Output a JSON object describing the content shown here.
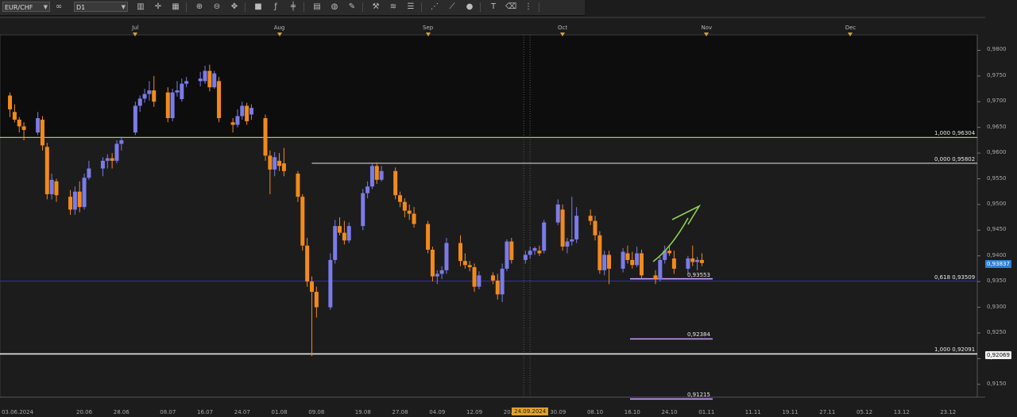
{
  "toolbar": {
    "symbol": "EUR/CHF",
    "timeframe": "D1",
    "icons": [
      "link-icon",
      "candles-icon",
      "crosshair-icon",
      "bar-chart-icon",
      "zoom-in-icon",
      "zoom-out-icon",
      "drag-icon",
      "color-icon",
      "indicator-icon",
      "hline-icon",
      "template-icon",
      "palette-icon",
      "pencil-icon",
      "tools-icon",
      "channel-icon",
      "fibo-icon",
      "gann-icon",
      "trend-icon",
      "shape-icon",
      "text-icon",
      "eraser-icon",
      "settings-icon"
    ]
  },
  "months": [
    {
      "label": "Jul",
      "date": "2024-07-01"
    },
    {
      "label": "Aug",
      "date": "2024-08-01"
    },
    {
      "label": "Sep",
      "date": "2024-09-02"
    },
    {
      "label": "Oct",
      "date": "2024-10-01"
    },
    {
      "label": "Nov",
      "date": "2024-11-01"
    },
    {
      "label": "Dec",
      "date": "2024-12-02"
    }
  ],
  "x_labels": [
    {
      "label": "03.06.2024",
      "date": "2024-06-03"
    },
    {
      "label": "20.06",
      "date": "2024-06-20"
    },
    {
      "label": "28.06",
      "date": "2024-06-28"
    },
    {
      "label": "08.07",
      "date": "2024-07-08"
    },
    {
      "label": "16.07",
      "date": "2024-07-16"
    },
    {
      "label": "24.07",
      "date": "2024-07-24"
    },
    {
      "label": "01.08",
      "date": "2024-08-01"
    },
    {
      "label": "09.08",
      "date": "2024-08-09"
    },
    {
      "label": "19.08",
      "date": "2024-08-19"
    },
    {
      "label": "27.08",
      "date": "2024-08-27"
    },
    {
      "label": "04.09",
      "date": "2024-09-04"
    },
    {
      "label": "12.09",
      "date": "2024-09-12"
    },
    {
      "label": "20.09",
      "date": "2024-09-20"
    },
    {
      "label": "30.09",
      "date": "2024-09-30"
    },
    {
      "label": "08.10",
      "date": "2024-10-08"
    },
    {
      "label": "16.10",
      "date": "2024-10-16"
    },
    {
      "label": "24.10",
      "date": "2024-10-24"
    },
    {
      "label": "01.11",
      "date": "2024-11-01"
    },
    {
      "label": "11.11",
      "date": "2024-11-11"
    },
    {
      "label": "19.11",
      "date": "2024-11-19"
    },
    {
      "label": "27.11",
      "date": "2024-11-27"
    },
    {
      "label": "05.12",
      "date": "2024-12-05"
    },
    {
      "label": "13.12",
      "date": "2024-12-13"
    },
    {
      "label": "23.12",
      "date": "2024-12-23"
    }
  ],
  "crosshair": {
    "label": "24.09.2024",
    "date": "2024-09-24"
  },
  "price_axis": [
    "0,9800",
    "0,9750",
    "0,9700",
    "0,9650",
    "0,9600",
    "0,9550",
    "0,9500",
    "0,9450",
    "0,9400",
    "0,9350",
    "0,9300",
    "0,9250",
    "0,9200",
    "0,9150"
  ],
  "levels": [
    {
      "label": "1,000 0,96304",
      "price": 0.96304,
      "color": "#8fd14f"
    },
    {
      "label": "0,000 0,95802",
      "price": 0.95802,
      "color": "#cfcfcf"
    },
    {
      "label": "0,618 0,93509",
      "price": 0.93509,
      "color": "#2c2ca8"
    },
    {
      "label": "1,000 0,92091",
      "price": 0.92091,
      "color": "#e8e8e8"
    }
  ],
  "targets": [
    {
      "label": "0,93553",
      "price": 0.93553
    },
    {
      "label": "0,92384",
      "price": 0.92384
    },
    {
      "label": "0,91215",
      "price": 0.91215
    }
  ],
  "current_price": {
    "label": "0,93837",
    "price": 0.93837
  },
  "low_marker": {
    "label": "0,92069",
    "price": 0.92069
  },
  "colors": {
    "bull": "#7b7be8",
    "bear": "#f28a1c",
    "arrow": "#8fd14f",
    "target": "#c9a0ff"
  },
  "chart_data": {
    "type": "candlestick",
    "title": "EUR/CHF D1",
    "ylim": [
      0.9125,
      0.983
    ],
    "ohlc": [
      {
        "date": "2024-06-04",
        "o": 0.9712,
        "h": 0.9718,
        "l": 0.967,
        "c": 0.9685
      },
      {
        "date": "2024-06-05",
        "o": 0.968,
        "h": 0.9695,
        "l": 0.966,
        "c": 0.9665
      },
      {
        "date": "2024-06-06",
        "o": 0.9665,
        "h": 0.967,
        "l": 0.964,
        "c": 0.9652
      },
      {
        "date": "2024-06-07",
        "o": 0.9652,
        "h": 0.966,
        "l": 0.9625,
        "c": 0.9645
      },
      {
        "date": "2024-06-10",
        "o": 0.964,
        "h": 0.968,
        "l": 0.9635,
        "c": 0.9668
      },
      {
        "date": "2024-06-11",
        "o": 0.9665,
        "h": 0.9672,
        "l": 0.9605,
        "c": 0.9615
      },
      {
        "date": "2024-06-12",
        "o": 0.9612,
        "h": 0.962,
        "l": 0.951,
        "c": 0.952
      },
      {
        "date": "2024-06-13",
        "o": 0.952,
        "h": 0.956,
        "l": 0.951,
        "c": 0.9548
      },
      {
        "date": "2024-06-14",
        "o": 0.9545,
        "h": 0.955,
        "l": 0.9505,
        "c": 0.9518
      },
      {
        "date": "2024-06-17",
        "o": 0.9515,
        "h": 0.9528,
        "l": 0.948,
        "c": 0.949
      },
      {
        "date": "2024-06-18",
        "o": 0.949,
        "h": 0.9535,
        "l": 0.948,
        "c": 0.9525
      },
      {
        "date": "2024-06-19",
        "o": 0.9525,
        "h": 0.9545,
        "l": 0.9485,
        "c": 0.9495
      },
      {
        "date": "2024-06-20",
        "o": 0.9495,
        "h": 0.956,
        "l": 0.949,
        "c": 0.9552
      },
      {
        "date": "2024-06-21",
        "o": 0.9552,
        "h": 0.9585,
        "l": 0.9548,
        "c": 0.957
      },
      {
        "date": "2024-06-24",
        "o": 0.957,
        "h": 0.9592,
        "l": 0.9555,
        "c": 0.9585
      },
      {
        "date": "2024-06-25",
        "o": 0.9585,
        "h": 0.9598,
        "l": 0.957,
        "c": 0.959
      },
      {
        "date": "2024-06-26",
        "o": 0.959,
        "h": 0.96,
        "l": 0.957,
        "c": 0.9585
      },
      {
        "date": "2024-06-27",
        "o": 0.9585,
        "h": 0.9625,
        "l": 0.958,
        "c": 0.9618
      },
      {
        "date": "2024-06-28",
        "o": 0.9618,
        "h": 0.9632,
        "l": 0.9605,
        "c": 0.9625
      },
      {
        "date": "2024-07-01",
        "o": 0.964,
        "h": 0.97,
        "l": 0.9635,
        "c": 0.9692
      },
      {
        "date": "2024-07-02",
        "o": 0.9692,
        "h": 0.9712,
        "l": 0.968,
        "c": 0.9706
      },
      {
        "date": "2024-07-03",
        "o": 0.9706,
        "h": 0.9725,
        "l": 0.9698,
        "c": 0.9715
      },
      {
        "date": "2024-07-04",
        "o": 0.9715,
        "h": 0.974,
        "l": 0.9702,
        "c": 0.9722
      },
      {
        "date": "2024-07-05",
        "o": 0.9722,
        "h": 0.975,
        "l": 0.969,
        "c": 0.97
      },
      {
        "date": "2024-07-08",
        "o": 0.9718,
        "h": 0.9728,
        "l": 0.966,
        "c": 0.9668
      },
      {
        "date": "2024-07-09",
        "o": 0.9668,
        "h": 0.9725,
        "l": 0.9662,
        "c": 0.9718
      },
      {
        "date": "2024-07-10",
        "o": 0.9718,
        "h": 0.974,
        "l": 0.971,
        "c": 0.9722
      },
      {
        "date": "2024-07-11",
        "o": 0.9705,
        "h": 0.9745,
        "l": 0.97,
        "c": 0.9735
      },
      {
        "date": "2024-07-12",
        "o": 0.9735,
        "h": 0.9748,
        "l": 0.9728,
        "c": 0.974
      },
      {
        "date": "2024-07-15",
        "o": 0.974,
        "h": 0.9758,
        "l": 0.973,
        "c": 0.9745
      },
      {
        "date": "2024-07-16",
        "o": 0.974,
        "h": 0.977,
        "l": 0.9735,
        "c": 0.976
      },
      {
        "date": "2024-07-17",
        "o": 0.976,
        "h": 0.9772,
        "l": 0.972,
        "c": 0.9728
      },
      {
        "date": "2024-07-18",
        "o": 0.9728,
        "h": 0.976,
        "l": 0.9725,
        "c": 0.9755
      },
      {
        "date": "2024-07-19",
        "o": 0.974,
        "h": 0.9748,
        "l": 0.966,
        "c": 0.9668
      },
      {
        "date": "2024-07-22",
        "o": 0.966,
        "h": 0.9668,
        "l": 0.964,
        "c": 0.9655
      },
      {
        "date": "2024-07-23",
        "o": 0.9655,
        "h": 0.9685,
        "l": 0.965,
        "c": 0.9672
      },
      {
        "date": "2024-07-24",
        "o": 0.9672,
        "h": 0.97,
        "l": 0.9665,
        "c": 0.9692
      },
      {
        "date": "2024-07-25",
        "o": 0.9692,
        "h": 0.9698,
        "l": 0.9655,
        "c": 0.9662
      },
      {
        "date": "2024-07-26",
        "o": 0.9675,
        "h": 0.9695,
        "l": 0.9665,
        "c": 0.9688
      },
      {
        "date": "2024-07-29",
        "o": 0.9668,
        "h": 0.9675,
        "l": 0.9585,
        "c": 0.9595
      },
      {
        "date": "2024-07-30",
        "o": 0.9595,
        "h": 0.9605,
        "l": 0.952,
        "c": 0.9568
      },
      {
        "date": "2024-07-31",
        "o": 0.9568,
        "h": 0.9602,
        "l": 0.9555,
        "c": 0.9592
      },
      {
        "date": "2024-08-01",
        "o": 0.9585,
        "h": 0.96,
        "l": 0.9565,
        "c": 0.9575
      },
      {
        "date": "2024-08-02",
        "o": 0.958,
        "h": 0.961,
        "l": 0.9555,
        "c": 0.9565
      },
      {
        "date": "2024-08-05",
        "o": 0.956,
        "h": 0.9565,
        "l": 0.9505,
        "c": 0.9515
      },
      {
        "date": "2024-08-06",
        "o": 0.9515,
        "h": 0.952,
        "l": 0.941,
        "c": 0.942
      },
      {
        "date": "2024-08-07",
        "o": 0.942,
        "h": 0.9435,
        "l": 0.934,
        "c": 0.935
      },
      {
        "date": "2024-08-08",
        "o": 0.935,
        "h": 0.936,
        "l": 0.9205,
        "c": 0.933
      },
      {
        "date": "2024-08-09",
        "o": 0.933,
        "h": 0.934,
        "l": 0.928,
        "c": 0.93
      },
      {
        "date": "2024-08-12",
        "o": 0.93,
        "h": 0.9405,
        "l": 0.9295,
        "c": 0.9392
      },
      {
        "date": "2024-08-13",
        "o": 0.9392,
        "h": 0.947,
        "l": 0.9385,
        "c": 0.9458
      },
      {
        "date": "2024-08-14",
        "o": 0.9458,
        "h": 0.9475,
        "l": 0.944,
        "c": 0.9445
      },
      {
        "date": "2024-08-15",
        "o": 0.9445,
        "h": 0.9468,
        "l": 0.9422,
        "c": 0.943
      },
      {
        "date": "2024-08-16",
        "o": 0.943,
        "h": 0.9465,
        "l": 0.9425,
        "c": 0.9458
      },
      {
        "date": "2024-08-19",
        "o": 0.9458,
        "h": 0.953,
        "l": 0.945,
        "c": 0.9522
      },
      {
        "date": "2024-08-20",
        "o": 0.9522,
        "h": 0.9545,
        "l": 0.9512,
        "c": 0.9535
      },
      {
        "date": "2024-08-21",
        "o": 0.9535,
        "h": 0.958,
        "l": 0.953,
        "c": 0.9575
      },
      {
        "date": "2024-08-22",
        "o": 0.9575,
        "h": 0.9582,
        "l": 0.954,
        "c": 0.9548
      },
      {
        "date": "2024-08-23",
        "o": 0.9548,
        "h": 0.9575,
        "l": 0.9545,
        "c": 0.9565
      },
      {
        "date": "2024-08-26",
        "o": 0.9565,
        "h": 0.9572,
        "l": 0.951,
        "c": 0.9518
      },
      {
        "date": "2024-08-27",
        "o": 0.9518,
        "h": 0.9525,
        "l": 0.9495,
        "c": 0.9505
      },
      {
        "date": "2024-08-28",
        "o": 0.9505,
        "h": 0.9512,
        "l": 0.9475,
        "c": 0.9488
      },
      {
        "date": "2024-08-29",
        "o": 0.9488,
        "h": 0.95,
        "l": 0.947,
        "c": 0.9482
      },
      {
        "date": "2024-08-30",
        "o": 0.9482,
        "h": 0.9495,
        "l": 0.9455,
        "c": 0.9462
      },
      {
        "date": "2024-09-02",
        "o": 0.9462,
        "h": 0.9468,
        "l": 0.9405,
        "c": 0.9412
      },
      {
        "date": "2024-09-03",
        "o": 0.9412,
        "h": 0.9418,
        "l": 0.935,
        "c": 0.936
      },
      {
        "date": "2024-09-04",
        "o": 0.936,
        "h": 0.9372,
        "l": 0.9345,
        "c": 0.9365
      },
      {
        "date": "2024-09-05",
        "o": 0.9365,
        "h": 0.938,
        "l": 0.9355,
        "c": 0.9372
      },
      {
        "date": "2024-09-06",
        "o": 0.9372,
        "h": 0.9435,
        "l": 0.9365,
        "c": 0.9425
      },
      {
        "date": "2024-09-09",
        "o": 0.9425,
        "h": 0.944,
        "l": 0.938,
        "c": 0.939
      },
      {
        "date": "2024-09-10",
        "o": 0.939,
        "h": 0.9405,
        "l": 0.9375,
        "c": 0.9382
      },
      {
        "date": "2024-09-11",
        "o": 0.9382,
        "h": 0.939,
        "l": 0.937,
        "c": 0.9378
      },
      {
        "date": "2024-09-12",
        "o": 0.9378,
        "h": 0.9385,
        "l": 0.933,
        "c": 0.934
      },
      {
        "date": "2024-09-13",
        "o": 0.934,
        "h": 0.937,
        "l": 0.9335,
        "c": 0.9362
      },
      {
        "date": "2024-09-16",
        "o": 0.9362,
        "h": 0.9368,
        "l": 0.9345,
        "c": 0.9352
      },
      {
        "date": "2024-09-17",
        "o": 0.9352,
        "h": 0.9365,
        "l": 0.9315,
        "c": 0.9325
      },
      {
        "date": "2024-09-18",
        "o": 0.9325,
        "h": 0.9385,
        "l": 0.931,
        "c": 0.9375
      },
      {
        "date": "2024-09-19",
        "o": 0.9375,
        "h": 0.9432,
        "l": 0.937,
        "c": 0.9428
      },
      {
        "date": "2024-09-20",
        "o": 0.9428,
        "h": 0.9435,
        "l": 0.9385,
        "c": 0.9392
      },
      {
        "date": "2024-09-23",
        "o": 0.9392,
        "h": 0.941,
        "l": 0.9385,
        "c": 0.9402
      },
      {
        "date": "2024-09-24",
        "o": 0.9402,
        "h": 0.9418,
        "l": 0.9395,
        "c": 0.941
      },
      {
        "date": "2024-09-25",
        "o": 0.941,
        "h": 0.9418,
        "l": 0.9402,
        "c": 0.9415
      },
      {
        "date": "2024-09-26",
        "o": 0.941,
        "h": 0.942,
        "l": 0.94,
        "c": 0.9405
      },
      {
        "date": "2024-09-27",
        "o": 0.941,
        "h": 0.947,
        "l": 0.9405,
        "c": 0.9465
      },
      {
        "date": "2024-09-30",
        "o": 0.9465,
        "h": 0.951,
        "l": 0.946,
        "c": 0.95
      },
      {
        "date": "2024-10-01",
        "o": 0.949,
        "h": 0.95,
        "l": 0.941,
        "c": 0.9418
      },
      {
        "date": "2024-10-02",
        "o": 0.9418,
        "h": 0.9435,
        "l": 0.9405,
        "c": 0.9428
      },
      {
        "date": "2024-10-03",
        "o": 0.9428,
        "h": 0.9515,
        "l": 0.942,
        "c": 0.9432
      },
      {
        "date": "2024-10-04",
        "o": 0.9432,
        "h": 0.9495,
        "l": 0.9425,
        "c": 0.9478
      },
      {
        "date": "2024-10-07",
        "o": 0.9478,
        "h": 0.949,
        "l": 0.946,
        "c": 0.9468
      },
      {
        "date": "2024-10-08",
        "o": 0.9468,
        "h": 0.9478,
        "l": 0.943,
        "c": 0.944
      },
      {
        "date": "2024-10-09",
        "o": 0.944,
        "h": 0.9448,
        "l": 0.9365,
        "c": 0.9372
      },
      {
        "date": "2024-10-10",
        "o": 0.9372,
        "h": 0.941,
        "l": 0.9362,
        "c": 0.9402
      },
      {
        "date": "2024-10-11",
        "o": 0.9402,
        "h": 0.941,
        "l": 0.9345,
        "c": 0.9375
      },
      {
        "date": "2024-10-14",
        "o": 0.9375,
        "h": 0.9415,
        "l": 0.9368,
        "c": 0.9408
      },
      {
        "date": "2024-10-15",
        "o": 0.9405,
        "h": 0.942,
        "l": 0.9385,
        "c": 0.9392
      },
      {
        "date": "2024-10-16",
        "o": 0.9392,
        "h": 0.9408,
        "l": 0.9375,
        "c": 0.9382
      },
      {
        "date": "2024-10-17",
        "o": 0.9382,
        "h": 0.9418,
        "l": 0.9378,
        "c": 0.9405
      },
      {
        "date": "2024-10-18",
        "o": 0.9405,
        "h": 0.9412,
        "l": 0.9355,
        "c": 0.9362
      },
      {
        "date": "2024-10-21",
        "o": 0.9362,
        "h": 0.9372,
        "l": 0.9345,
        "c": 0.9355
      },
      {
        "date": "2024-10-22",
        "o": 0.9355,
        "h": 0.9398,
        "l": 0.935,
        "c": 0.9392
      },
      {
        "date": "2024-10-23",
        "o": 0.9392,
        "h": 0.942,
        "l": 0.9385,
        "c": 0.941
      },
      {
        "date": "2024-10-24",
        "o": 0.941,
        "h": 0.9418,
        "l": 0.94,
        "c": 0.9405
      },
      {
        "date": "2024-10-25",
        "o": 0.9395,
        "h": 0.941,
        "l": 0.9365,
        "c": 0.9375
      },
      {
        "date": "2024-10-28",
        "o": 0.9375,
        "h": 0.94,
        "l": 0.9365,
        "c": 0.9395
      },
      {
        "date": "2024-10-29",
        "o": 0.9395,
        "h": 0.942,
        "l": 0.938,
        "c": 0.9388
      },
      {
        "date": "2024-10-30",
        "o": 0.9388,
        "h": 0.9398,
        "l": 0.9372,
        "c": 0.9392
      },
      {
        "date": "2024-10-31",
        "o": 0.9392,
        "h": 0.9405,
        "l": 0.938,
        "c": 0.9386
      }
    ]
  }
}
